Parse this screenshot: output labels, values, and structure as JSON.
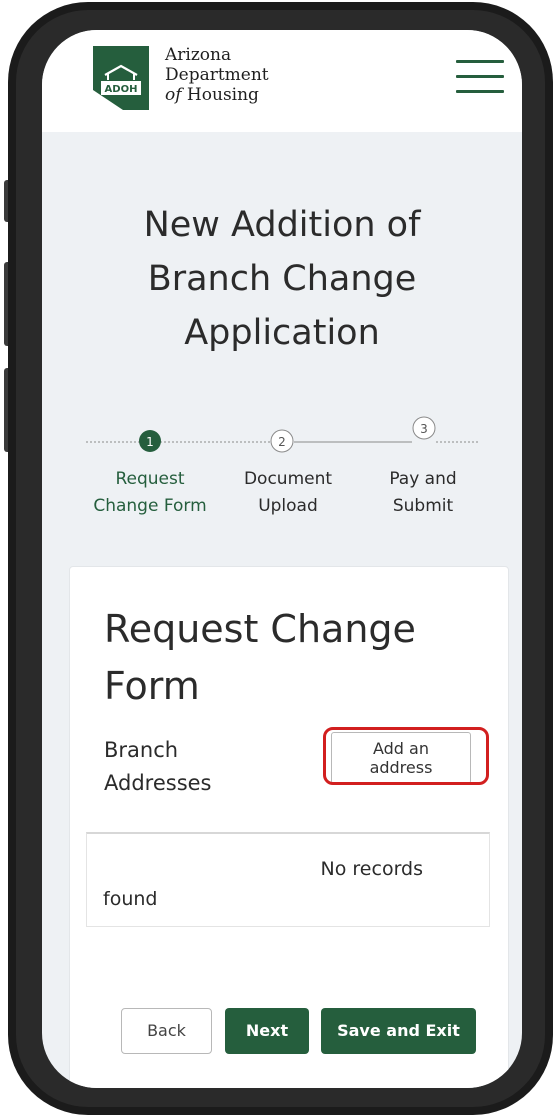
{
  "header": {
    "logo_badge": "ADOH",
    "logo_line1": "Arizona",
    "logo_line2": "Department",
    "logo_line3_italic": "of",
    "logo_line3_rest": " Housing",
    "menu_icon": "hamburger-menu-icon"
  },
  "page": {
    "title_line1": "New Addition of",
    "title_line2": "Branch Change",
    "title_line3": "Application"
  },
  "steps": [
    {
      "number": "1",
      "line1": "Request",
      "line2": "Change Form",
      "active": true
    },
    {
      "number": "2",
      "line1": "Document",
      "line2": "Upload",
      "active": false
    },
    {
      "number": "3",
      "line1": "Pay and",
      "line2": "Submit",
      "active": false
    }
  ],
  "form": {
    "title_line1": "Request Change",
    "title_line2": "Form",
    "branch_line1": "Branch",
    "branch_line2": "Addresses",
    "add_line1": "Add an",
    "add_line2": "address",
    "empty_line1": "No records",
    "empty_line2": "found"
  },
  "buttons": {
    "back": "Back",
    "next": "Next",
    "save": "Save and Exit"
  },
  "colors": {
    "brand_green": "#255e3d",
    "highlight_red": "#d21f1f",
    "background": "#eef1f4"
  }
}
